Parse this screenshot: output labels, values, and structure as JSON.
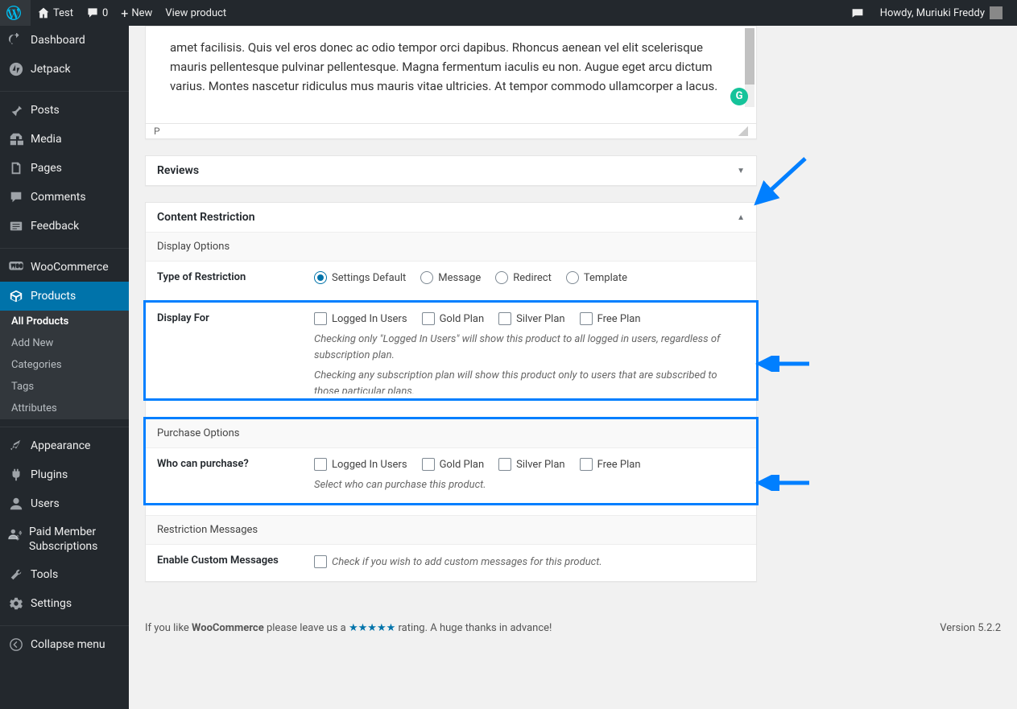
{
  "adminbar": {
    "site_name": "Test",
    "comments_count": "0",
    "new_label": "New",
    "view_product": "View product",
    "howdy": "Howdy, Muriuki Freddy"
  },
  "menu": {
    "dashboard": "Dashboard",
    "jetpack": "Jetpack",
    "posts": "Posts",
    "media": "Media",
    "pages": "Pages",
    "comments": "Comments",
    "feedback": "Feedback",
    "woocommerce": "WooCommerce",
    "products": "Products",
    "products_sub": {
      "all": "All Products",
      "add": "Add New",
      "categories": "Categories",
      "tags": "Tags",
      "attributes": "Attributes"
    },
    "appearance": "Appearance",
    "plugins": "Plugins",
    "users": "Users",
    "paid_member": "Paid Member Subscriptions",
    "tools": "Tools",
    "settings": "Settings",
    "collapse": "Collapse menu"
  },
  "editor": {
    "text": "amet facilisis. Quis vel eros donec ac odio tempor orci dapibus. Rhoncus aenean vel elit scelerisque mauris pellentesque pulvinar pellentesque. Magna fermentum iaculis eu non. Augue eget arcu dictum varius. Montes nascetur ridiculus mus mauris vitae ultricies. At tempor commodo ullamcorper a lacus.",
    "path": "P"
  },
  "reviews": {
    "title": "Reviews"
  },
  "content_restriction": {
    "title": "Content Restriction",
    "display_options": "Display Options",
    "type_label": "Type of Restriction",
    "type_opts": {
      "default": "Settings Default",
      "message": "Message",
      "redirect": "Redirect",
      "template": "Template"
    },
    "display_for_label": "Display For",
    "plan_opts": {
      "logged_in": "Logged In Users",
      "gold": "Gold Plan",
      "silver": "Silver Plan",
      "free": "Free Plan"
    },
    "display_for_help1": "Checking only \"Logged In Users\" will show this product to all logged in users, regardless of subscription plan.",
    "display_for_help2": "Checking any subscription plan will show this product only to users that are subscribed to those particular plans.",
    "purchase_options": "Purchase Options",
    "who_purchase_label": "Who can purchase?",
    "who_purchase_help": "Select who can purchase this product.",
    "restriction_messages": "Restriction Messages",
    "enable_custom_label": "Enable Custom Messages",
    "enable_custom_help": "Check if you wish to add custom messages for this product."
  },
  "footer": {
    "like_pre": "If you like ",
    "woo": "WooCommerce",
    "like_mid": " please leave us a ",
    "stars": "★★★★★",
    "like_post": " rating. A huge thanks in advance!",
    "version": "Version 5.2.2"
  }
}
